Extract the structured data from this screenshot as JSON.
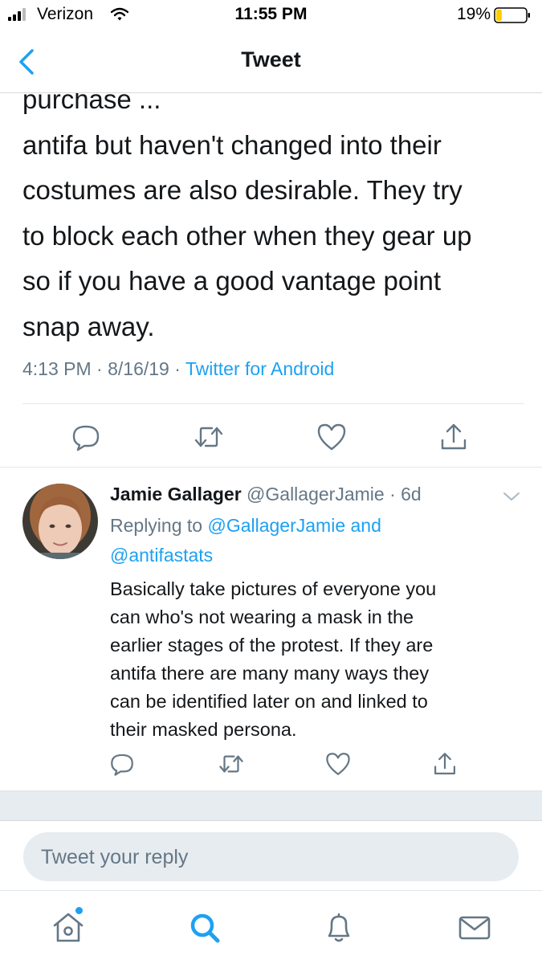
{
  "status_bar": {
    "carrier": "Verizon",
    "time": "11:55 PM",
    "battery": "19%",
    "battery_level": 0.19,
    "battery_color": "#ffcc00"
  },
  "nav": {
    "title": "Tweet",
    "back_icon": "chevron-left-icon"
  },
  "tweet": {
    "text": "purchase ...\nantifa but haven't changed into their\ncostumes are also desirable. They try\nto block each other when they gear up\nso if you have a good vantage point\nsnap away.",
    "time": "4:13 PM",
    "date": "8/16/19",
    "separator": "·",
    "source": "Twitter for Android",
    "actions": [
      "reply-icon",
      "retweet-icon",
      "like-icon",
      "share-icon"
    ]
  },
  "reply": {
    "name": "Jamie Gallager",
    "handle": "@GallagerJamie",
    "dot": "·",
    "time": "6d",
    "replying_prefix": "Replying to",
    "mention1": "@GallagerJamie",
    "and_word": "and",
    "mention2": "@antifastats",
    "text": "Basically take pictures of everyone you\ncan who's not wearing a mask in the\nearlier stages of the protest. If they are\nantifa there are many many ways they\ncan be identified later on and linked to\ntheir masked persona.",
    "actions": [
      "reply-icon",
      "retweet-icon",
      "like-icon",
      "share-icon"
    ]
  },
  "composer": {
    "placeholder": "Tweet your reply"
  },
  "tabbar": {
    "items": [
      "home-icon",
      "search-icon",
      "notifications-icon",
      "messages-icon"
    ],
    "active": "search-icon",
    "accent": "#1da1f2"
  }
}
